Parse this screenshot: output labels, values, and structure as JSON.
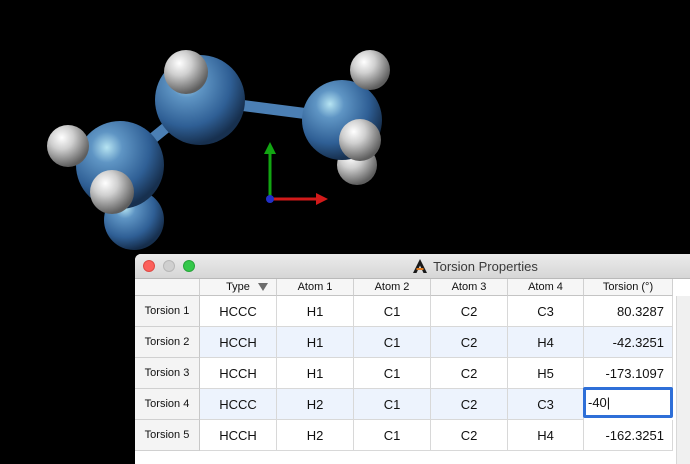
{
  "window": {
    "title": "Torsion Properties"
  },
  "table": {
    "headers": [
      "Type",
      "Atom 1",
      "Atom 2",
      "Atom 3",
      "Atom 4",
      "Torsion (°)"
    ],
    "rows": [
      {
        "label": "Torsion 1",
        "type": "HCCC",
        "atom1": "H1",
        "atom2": "C1",
        "atom3": "C2",
        "atom4": "C3",
        "torsion": "80.3287"
      },
      {
        "label": "Torsion 2",
        "type": "HCCH",
        "atom1": "H1",
        "atom2": "C1",
        "atom3": "C2",
        "atom4": "H4",
        "torsion": "-42.3251"
      },
      {
        "label": "Torsion 3",
        "type": "HCCH",
        "atom1": "H1",
        "atom2": "C1",
        "atom3": "C2",
        "atom4": "H5",
        "torsion": "-173.1097"
      },
      {
        "label": "Torsion 4",
        "type": "HCCC",
        "atom1": "H2",
        "atom2": "C1",
        "atom3": "C2",
        "atom4": "C3",
        "torsion": "-40|"
      },
      {
        "label": "Torsion 5",
        "type": "HCCH",
        "atom1": "H2",
        "atom2": "C1",
        "atom3": "C2",
        "atom4": "H4",
        "torsion": "-162.3251"
      }
    ]
  },
  "colors": {
    "carbon": "#3f73a8",
    "hydrogen": "#d8d8d8",
    "axis_x": "#d21a1a",
    "axis_y": "#12a512",
    "axis_z": "#2130c8",
    "selection": "#2e6fd8"
  }
}
